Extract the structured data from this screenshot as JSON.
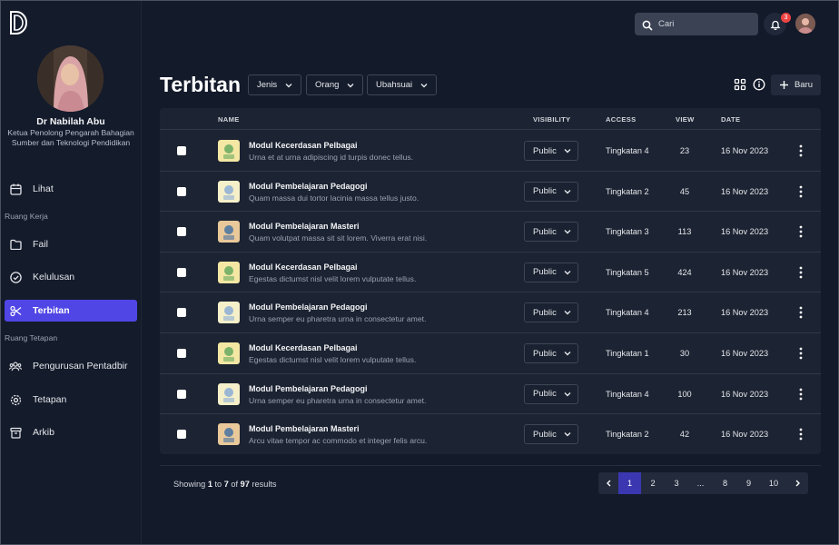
{
  "sidebar": {
    "profile": {
      "name": "Dr Nabilah Abu",
      "role": "Ketua Penolong Pengarah Bahagian Sumber dan Teknologi Pendidikan"
    },
    "items": [
      {
        "label": "Lihat",
        "icon": "calendar-icon"
      },
      {
        "label": "Fail",
        "icon": "folder-icon"
      },
      {
        "label": "Kelulusan",
        "icon": "check-circle-icon"
      },
      {
        "label": "Terbitan",
        "icon": "scissors-icon",
        "active": true
      },
      {
        "label": "Pengurusan Pentadbir",
        "icon": "users-icon"
      },
      {
        "label": "Tetapan",
        "icon": "gear-icon"
      },
      {
        "label": "Arkib",
        "icon": "archive-icon"
      }
    ],
    "sections": [
      "Ruang Kerja",
      "Ruang Tetapan"
    ]
  },
  "topbar": {
    "search_placeholder": "Cari",
    "notification_count": "3"
  },
  "header": {
    "title": "Terbitan",
    "filters": [
      "Jenis",
      "Orang",
      "Ubahsuai"
    ],
    "new_label": "Baru"
  },
  "table": {
    "columns": [
      "NAME",
      "VISIBILITY",
      "ACCESS",
      "VIEW",
      "DATE"
    ],
    "rows": [
      {
        "title": "Modul Kecerdasan Pelbagai",
        "desc": "Urna et at urna adipiscing id turpis donec tellus.",
        "visibility": "Public",
        "access": "Tingkatan 4",
        "view": "23",
        "date": "16 Nov 2023"
      },
      {
        "title": "Modul Pembelajaran Pedagogi",
        "desc": "Quam massa dui tortor lacinia massa tellus justo.",
        "visibility": "Public",
        "access": "Tingkatan 2",
        "view": "45",
        "date": "16 Nov 2023"
      },
      {
        "title": "Modul Pembelajaran Masteri",
        "desc": "Quam volutpat massa sit sit lorem. Viverra erat nisi.",
        "visibility": "Public",
        "access": "Tingkatan 3",
        "view": "113",
        "date": "16 Nov 2023"
      },
      {
        "title": "Modul Kecerdasan Pelbagai",
        "desc": "Egestas dictumst nisl velit lorem vulputate tellus.",
        "visibility": "Public",
        "access": "Tingkatan 5",
        "view": "424",
        "date": "16 Nov 2023"
      },
      {
        "title": "Modul Pembelajaran Pedagogi",
        "desc": "Urna semper eu pharetra urna in consectetur amet.",
        "visibility": "Public",
        "access": "Tingkatan 4",
        "view": "213",
        "date": "16 Nov 2023"
      },
      {
        "title": "Modul Kecerdasan Pelbagai",
        "desc": "Egestas dictumst nisl velit lorem vulputate tellus.",
        "visibility": "Public",
        "access": "Tingkatan 1",
        "view": "30",
        "date": "16 Nov 2023"
      },
      {
        "title": "Modul Pembelajaran Pedagogi",
        "desc": "Urna semper eu pharetra urna in consectetur amet.",
        "visibility": "Public",
        "access": "Tingkatan 4",
        "view": "100",
        "date": "16 Nov 2023"
      },
      {
        "title": "Modul Pembelajaran Masteri",
        "desc": "Arcu vitae tempor ac commodo et integer felis arcu.",
        "visibility": "Public",
        "access": "Tingkatan 2",
        "view": "42",
        "date": "16 Nov 2023"
      }
    ]
  },
  "footer": {
    "showing": "Showing",
    "from": "1",
    "to_word": "to",
    "to": "7",
    "of_word": "of",
    "total": "97",
    "results_word": "results"
  },
  "pagination": {
    "pages": [
      "1",
      "2",
      "3",
      "...",
      "8",
      "9",
      "10"
    ],
    "current": "1"
  },
  "colors": {
    "accent": "#5046e5",
    "background": "#131a2a",
    "table_bg": "#1c2332",
    "badge": "#ef4444"
  }
}
